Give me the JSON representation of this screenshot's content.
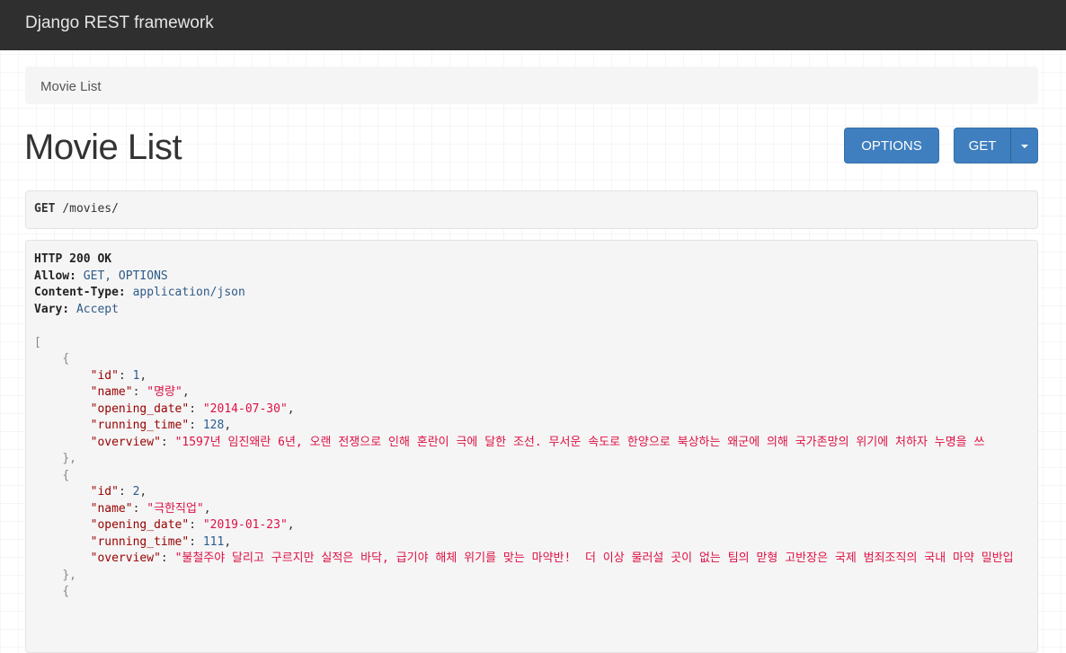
{
  "navbar": {
    "brand": "Django REST framework"
  },
  "breadcrumb": {
    "current": "Movie List"
  },
  "page": {
    "title": "Movie List"
  },
  "buttons": {
    "options": "OPTIONS",
    "get": "GET"
  },
  "request": {
    "method": "GET",
    "path": "/movies/"
  },
  "response": {
    "status": "HTTP 200 OK",
    "headers": [
      {
        "name": "Allow:",
        "value": "GET, OPTIONS"
      },
      {
        "name": "Content-Type:",
        "value": "application/json"
      },
      {
        "name": "Vary:",
        "value": "Accept"
      }
    ],
    "movies": [
      {
        "id": "1",
        "name": "\"명량\"",
        "opening_date": "\"2014-07-30\"",
        "running_time": "128",
        "overview": "\"1597년 임진왜란 6년, 오랜 전쟁으로 인해 혼란이 극에 달한 조선. 무서운 속도로 한양으로 북상하는 왜군에 의해 국가존망의 위기에 처하자 누명을 쓰"
      },
      {
        "id": "2",
        "name": "\"극한직업\"",
        "opening_date": "\"2019-01-23\"",
        "running_time": "111",
        "overview": "\"불철주야 달리고 구르지만 실적은 바닥, 급기야 해체 위기를 맞는 마약반!  더 이상 물러설 곳이 없는 팀의 맏형 고반장은 국제 범죄조직의 국내 마약 밀반입"
      }
    ],
    "keys": {
      "id": "\"id\"",
      "name": "\"name\"",
      "opening_date": "\"opening_date\"",
      "running_time": "\"running_time\"",
      "overview": "\"overview\""
    }
  },
  "colors": {
    "navbar": "#2f2f2f",
    "button": "#3f7fbf",
    "json_key": "#990000",
    "json_string": "#dd1144",
    "json_number": "#2a5d8f"
  }
}
